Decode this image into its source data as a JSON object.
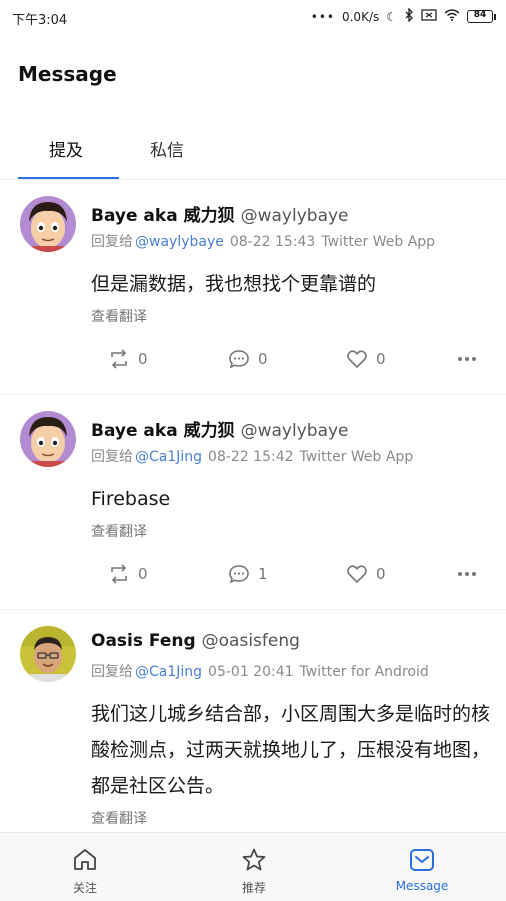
{
  "status_bar": {
    "time": "下午3:04",
    "network_speed": "0.0K/s",
    "battery": "84",
    "colors": {
      "battery_fill": "#3fb34f"
    }
  },
  "header": {
    "title": "Message"
  },
  "tabs": [
    {
      "label": "提及",
      "active": true
    },
    {
      "label": "私信",
      "active": false
    }
  ],
  "tweets": [
    {
      "display_name": "Baye aka 威力狈",
      "handle": "@waylybaye",
      "reply_prefix": "回复给",
      "reply_to": "@waylybaye",
      "date": "08-22 15:43",
      "client": "Twitter Web App",
      "text": "但是漏数据，我也想找个更靠谱的",
      "translate_label": "查看翻译",
      "retweets": "0",
      "comments": "0",
      "likes": "0",
      "avatar_icon": "cartoon-face-avatar"
    },
    {
      "display_name": "Baye aka 威力狈",
      "handle": "@waylybaye",
      "reply_prefix": "回复给",
      "reply_to": "@Ca1Jing",
      "date": "08-22 15:42",
      "client": "Twitter Web App",
      "text": "Firebase",
      "translate_label": "查看翻译",
      "retweets": "0",
      "comments": "1",
      "likes": "0",
      "avatar_icon": "cartoon-face-avatar"
    },
    {
      "display_name": "Oasis Feng",
      "handle": "@oasisfeng",
      "reply_prefix": "回复给",
      "reply_to": "@Ca1Jing",
      "date": "05-01 20:41",
      "client": "Twitter for Android",
      "text": "我们这儿城乡结合部，小区周围大多是临时的核酸检测点，过两天就换地儿了，压根没有地图，都是社区公告。",
      "translate_label": "查看翻译",
      "avatar_icon": "photo-avatar"
    }
  ],
  "bottom_nav": [
    {
      "label": "关注",
      "icon": "home-icon",
      "active": false
    },
    {
      "label": "推荐",
      "icon": "star-icon",
      "active": false
    },
    {
      "label": "Message",
      "icon": "mail-icon",
      "active": true
    }
  ],
  "colors": {
    "accent": "#2a6fdb",
    "link": "#4a7fd4",
    "meta": "#8a8a8a"
  }
}
